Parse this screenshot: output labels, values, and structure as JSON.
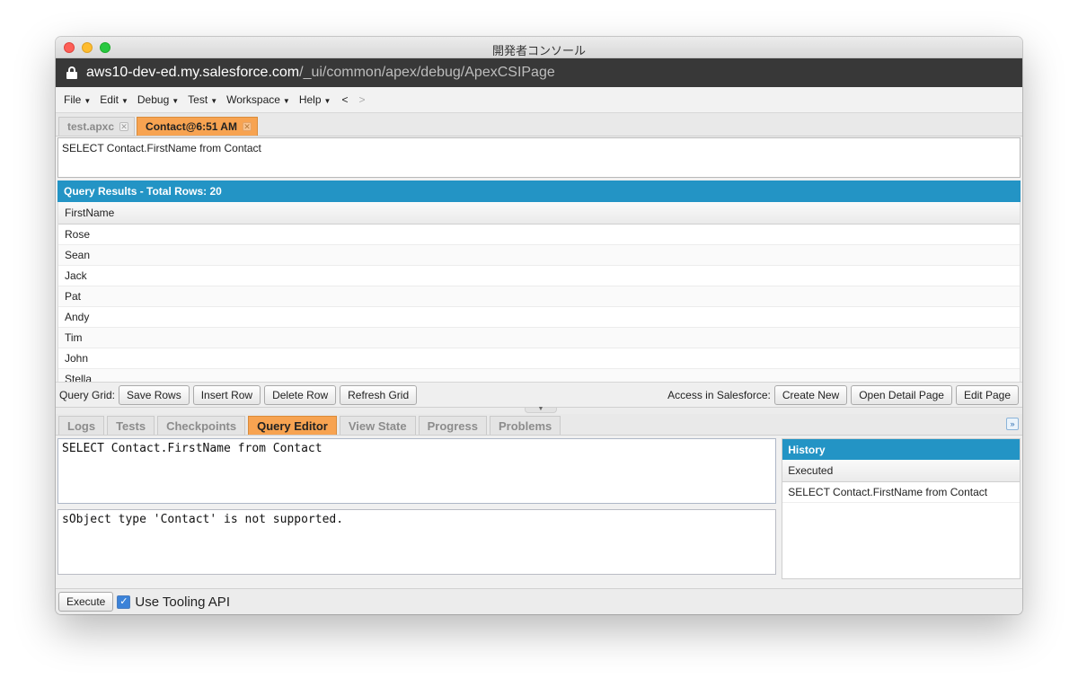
{
  "window": {
    "title": "開発者コンソール"
  },
  "address": {
    "host": "aws10-dev-ed.my.salesforce.com",
    "path": "/_ui/common/apex/debug/ApexCSIPage"
  },
  "menu": {
    "items": [
      {
        "label": "File"
      },
      {
        "label": "Edit"
      },
      {
        "label": "Debug"
      },
      {
        "label": "Test"
      },
      {
        "label": "Workspace"
      },
      {
        "label": "Help"
      }
    ],
    "back": "<",
    "forward": ">"
  },
  "editor_tabs": [
    {
      "label": "test.apxc",
      "active": false
    },
    {
      "label": "Contact@6:51 AM",
      "active": true
    }
  ],
  "query_text": "SELECT Contact.FirstName from Contact",
  "results": {
    "header": "Query Results - Total Rows: 20",
    "column": "FirstName",
    "rows": [
      "Rose",
      "Sean",
      "Jack",
      "Pat",
      "Andy",
      "Tim",
      "John",
      "Stella"
    ]
  },
  "grid_toolbar": {
    "label": "Query Grid:",
    "save_rows": "Save Rows",
    "insert_row": "Insert Row",
    "delete_row": "Delete Row",
    "refresh_grid": "Refresh Grid",
    "access_label": "Access in Salesforce:",
    "create_new": "Create New",
    "open_detail": "Open Detail Page",
    "edit_page": "Edit Page"
  },
  "bottom_tabs": [
    {
      "label": "Logs",
      "active": false
    },
    {
      "label": "Tests",
      "active": false
    },
    {
      "label": "Checkpoints",
      "active": false
    },
    {
      "label": "Query Editor",
      "active": true
    },
    {
      "label": "View State",
      "active": false
    },
    {
      "label": "Progress",
      "active": false
    },
    {
      "label": "Problems",
      "active": false
    }
  ],
  "query_editor": {
    "input": "SELECT Contact.FirstName from Contact",
    "output": "sObject type 'Contact' is not supported."
  },
  "history": {
    "header": "History",
    "column": "Executed",
    "rows": [
      "SELECT Contact.FirstName from Contact"
    ]
  },
  "execute_bar": {
    "execute": "Execute",
    "tooling_label": "Use Tooling API",
    "tooling_checked": true
  },
  "colors": {
    "accent_orange": "#f7a351",
    "header_blue": "#2394c5",
    "url_bar": "#383838"
  }
}
